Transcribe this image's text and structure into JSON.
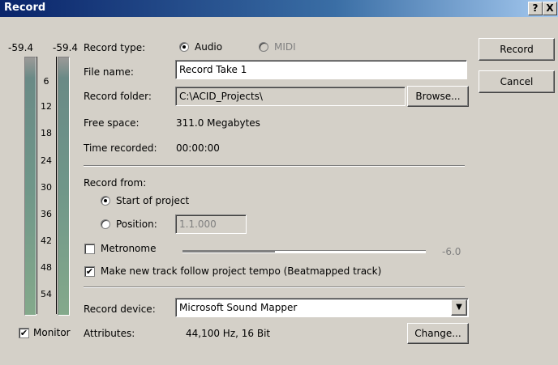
{
  "window": {
    "title": "Record"
  },
  "titlebar": {
    "help_label": "?",
    "close_label": "X"
  },
  "meters": {
    "left_peak": "-59.4",
    "right_peak": "-59.4",
    "scale": [
      "6",
      "12",
      "18",
      "24",
      "30",
      "36",
      "42",
      "48",
      "54"
    ]
  },
  "monitor": {
    "label": "Monitor",
    "checked": true
  },
  "record_type": {
    "label": "Record type:",
    "audio_label": "Audio",
    "midi_label": "MIDI",
    "selected": "Audio"
  },
  "file_name": {
    "label": "File name:",
    "value": "Record Take 1"
  },
  "record_folder": {
    "label": "Record folder:",
    "value": "C:\\ACID_Projects\\",
    "browse_label": "Browse..."
  },
  "free_space": {
    "label": "Free space:",
    "value": "311.0 Megabytes"
  },
  "time_recorded": {
    "label": "Time recorded:",
    "value": "00:00:00"
  },
  "record_from": {
    "label": "Record from:",
    "start_label": "Start of project",
    "position_label": "Position:",
    "position_value": "1.1.000",
    "selected": "Start of project"
  },
  "metronome": {
    "label": "Metronome",
    "checked": false,
    "level_text": "-6.0",
    "level_fraction": 0.38
  },
  "beatmapped": {
    "label": "Make new track follow project tempo (Beatmapped track)",
    "checked": true
  },
  "record_device": {
    "label": "Record device:",
    "value": "Microsoft Sound Mapper"
  },
  "attributes": {
    "label": "Attributes:",
    "value": "44,100 Hz, 16 Bit",
    "change_label": "Change..."
  },
  "buttons": {
    "record": "Record",
    "cancel": "Cancel"
  }
}
